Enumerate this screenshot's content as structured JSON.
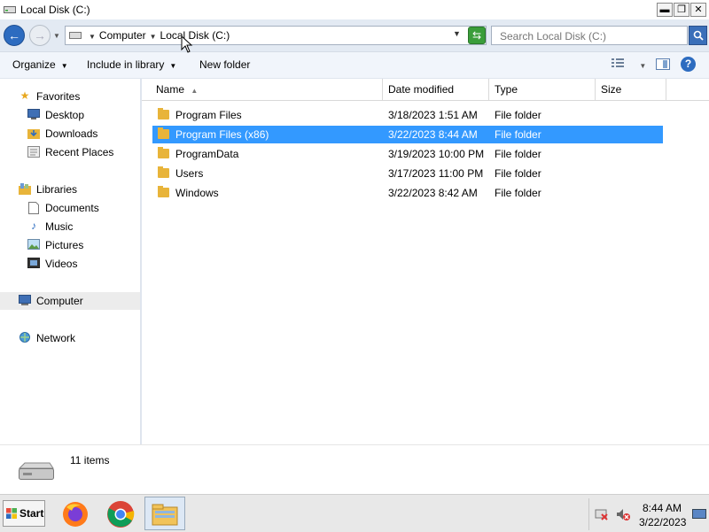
{
  "window": {
    "title": "Local Disk (C:)",
    "minimize_glyph": "▬",
    "maximize_glyph": "❐",
    "close_glyph": "✕"
  },
  "address_bar": {
    "breadcrumbs": [
      "Computer",
      "Local Disk (C:)"
    ],
    "search_placeholder": "Search Local Disk (C:)"
  },
  "toolbar": {
    "organize": "Organize",
    "include_in_library": "Include in library",
    "new_folder": "New folder"
  },
  "nav": {
    "favorites": {
      "label": "Favorites",
      "items": [
        "Desktop",
        "Downloads",
        "Recent Places"
      ]
    },
    "libraries": {
      "label": "Libraries",
      "items": [
        "Documents",
        "Music",
        "Pictures",
        "Videos"
      ]
    },
    "computer": "Computer",
    "network": "Network"
  },
  "columns": {
    "name": "Name",
    "date_modified": "Date modified",
    "type": "Type",
    "size": "Size"
  },
  "files": [
    {
      "name": "Program Files",
      "date": "3/18/2023 1:51 AM",
      "type": "File folder",
      "selected": false
    },
    {
      "name": "Program Files (x86)",
      "date": "3/22/2023 8:44 AM",
      "type": "File folder",
      "selected": true
    },
    {
      "name": "ProgramData",
      "date": "3/19/2023 10:00 PM",
      "type": "File folder",
      "selected": false
    },
    {
      "name": "Users",
      "date": "3/17/2023 11:00 PM",
      "type": "File folder",
      "selected": false
    },
    {
      "name": "Windows",
      "date": "3/22/2023 8:42 AM",
      "type": "File folder",
      "selected": false
    }
  ],
  "details": {
    "item_count": "11 items"
  },
  "taskbar": {
    "start": "Start",
    "clock_time": "8:44 AM",
    "clock_date": "3/22/2023"
  },
  "colors": {
    "selection": "#3399ff",
    "folder": "#e8b43a",
    "back_button": "#2d6cc0"
  },
  "icons": {
    "favorites": "star-icon",
    "libraries": "library-icon",
    "computer": "computer-icon",
    "network": "network-icon"
  }
}
